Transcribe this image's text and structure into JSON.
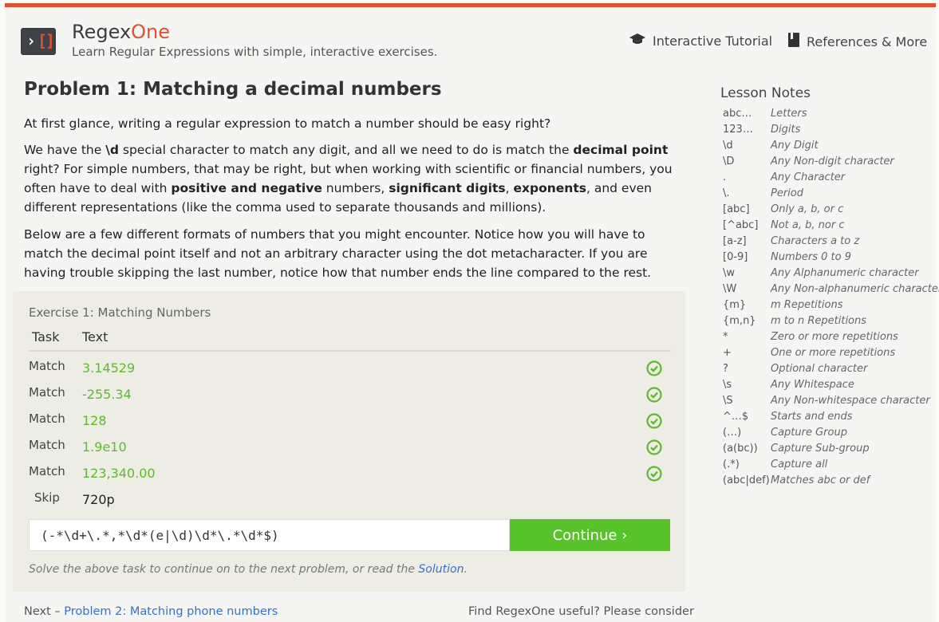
{
  "header": {
    "brand_main": "Regex",
    "brand_accent": "One",
    "tagline": "Learn Regular Expressions with simple, interactive exercises.",
    "logo_caret": "›",
    "logo_bracket": "[]",
    "nav": [
      {
        "label": "Interactive Tutorial",
        "icon": "graduation-cap-icon"
      },
      {
        "label": "References & More",
        "icon": "book-icon"
      }
    ]
  },
  "lesson": {
    "title": "Problem 1: Matching a decimal numbers",
    "p1": "At first glance, writing a regular expression to match a number should be easy right?",
    "p2": {
      "a": "We have the ",
      "b": "\\d",
      "c": " special character to match any digit, and all we need to do is match the ",
      "d": "decimal point",
      "e": " right? For simple numbers, that may be right, but when working with scientific or financial numbers, you often have to deal with ",
      "f": "positive and negative",
      "g": " numbers, ",
      "h": "significant digits",
      "i": ", ",
      "j": "exponents",
      "k": ", and even different representations (like the comma used to separate thousands and millions)."
    },
    "p3": "Below are a few different formats of numbers that you might encounter. Notice how you will have to match the decimal point itself and not an arbitrary character using the dot metacharacter. If you are having trouble skipping the last number, notice how that number ends the line compared to the rest."
  },
  "exercise": {
    "title": "Exercise 1: Matching Numbers",
    "col_task": "Task",
    "col_text": "Text",
    "rows": [
      {
        "task": "Match",
        "text": "3.14529",
        "ok": true
      },
      {
        "task": "Match",
        "text": "-255.34",
        "ok": true
      },
      {
        "task": "Match",
        "text": "128",
        "ok": true
      },
      {
        "task": "Match",
        "text": "1.9e10",
        "ok": true
      },
      {
        "task": "Match",
        "text": "123,340.00",
        "ok": true
      },
      {
        "task": "Skip",
        "text": "720p",
        "ok": false
      }
    ],
    "input_value": "(-*\\d+\\.*,*\\d*(e|\\d)\\d*\\.*\\d*$)",
    "continue_label": "Continue ›",
    "hint_prefix": "Solve the above task to continue on to the next problem, or read the ",
    "hint_link": "Solution",
    "hint_suffix": ".",
    "success_color": "#5fb930"
  },
  "footer": {
    "next_prefix": "Next – ",
    "next_link": "Problem 2: Matching phone numbers",
    "right_text": "Find RegexOne useful? Please consider"
  },
  "notes": {
    "title": "Lesson Notes",
    "items": [
      {
        "k": "abc…",
        "v": "Letters"
      },
      {
        "k": "123…",
        "v": "Digits"
      },
      {
        "k": "\\d",
        "v": "Any Digit"
      },
      {
        "k": "\\D",
        "v": "Any Non-digit character"
      },
      {
        "k": ".",
        "v": "Any Character"
      },
      {
        "k": "\\.",
        "v": "Period"
      },
      {
        "k": "[abc]",
        "v": "Only a, b, or c"
      },
      {
        "k": "[^abc]",
        "v": "Not a, b, nor c"
      },
      {
        "k": "[a-z]",
        "v": "Characters a to z"
      },
      {
        "k": "[0-9]",
        "v": "Numbers 0 to 9"
      },
      {
        "k": "\\w",
        "v": "Any Alphanumeric character"
      },
      {
        "k": "\\W",
        "v": "Any Non-alphanumeric character"
      },
      {
        "k": "{m}",
        "v": "m Repetitions"
      },
      {
        "k": "{m,n}",
        "v": "m to n Repetitions"
      },
      {
        "k": "*",
        "v": "Zero or more repetitions"
      },
      {
        "k": "+",
        "v": "One or more repetitions"
      },
      {
        "k": "?",
        "v": "Optional character"
      },
      {
        "k": "\\s",
        "v": "Any Whitespace"
      },
      {
        "k": "\\S",
        "v": "Any Non-whitespace character"
      },
      {
        "k": "^…$",
        "v": "Starts and ends"
      },
      {
        "k": "(…)",
        "v": "Capture Group"
      },
      {
        "k": "(a(bc))",
        "v": "Capture Sub-group"
      },
      {
        "k": "(.*)",
        "v": "Capture all"
      },
      {
        "k": "(abc|def)",
        "v": "Matches abc or def"
      }
    ]
  }
}
